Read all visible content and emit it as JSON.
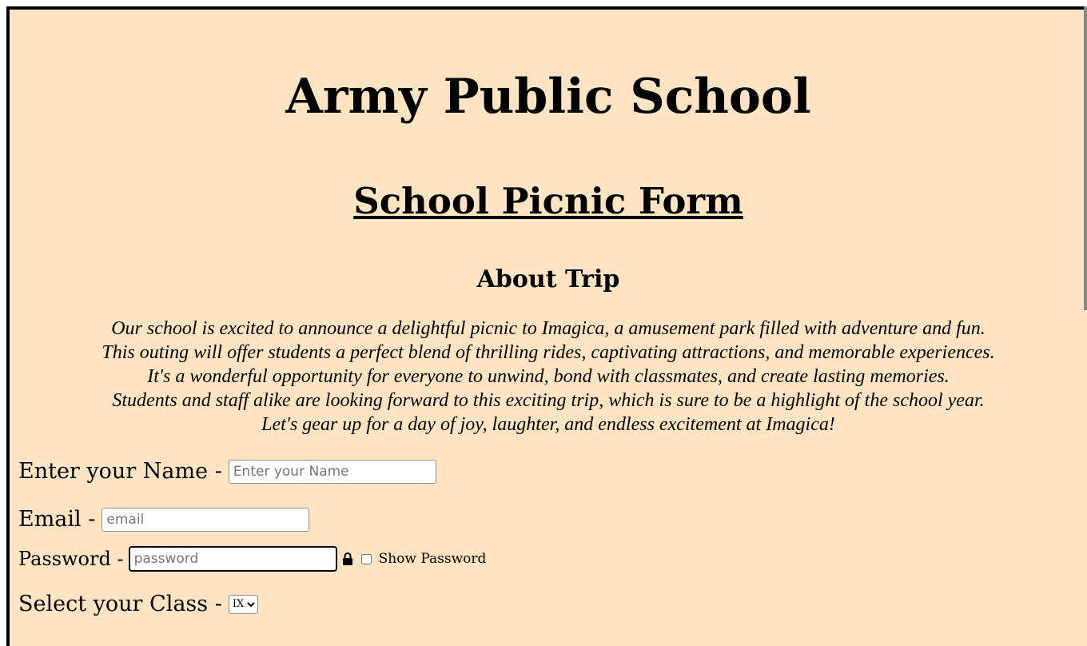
{
  "header": {
    "school_name": "Army Public School",
    "form_title": "School Picnic Form"
  },
  "about": {
    "heading": "About Trip",
    "lines": [
      "Our school is excited to announce a delightful picnic to Imagica, a amusement park filled with adventure and fun.",
      "This outing will offer students a perfect blend of thrilling rides, captivating attractions, and memorable experiences.",
      "It's a wonderful opportunity for everyone to unwind, bond with classmates, and create lasting memories.",
      "Students and staff alike are looking forward to this exciting trip, which is sure to be a highlight of the school year.",
      "Let's gear up for a day of joy, laughter, and endless excitement at Imagica!"
    ]
  },
  "form": {
    "name_label": "Enter your Name -",
    "name_placeholder": "Enter your Name",
    "email_label": "Email -",
    "email_placeholder": "email",
    "password_label": "Password -",
    "password_placeholder": "password",
    "password_icon": "lock-icon",
    "show_password_label": "Show Password",
    "class_label": "Select your Class -",
    "class_selected": "IX"
  },
  "colors": {
    "page_background": "#ffe4c4",
    "border": "#000000"
  }
}
